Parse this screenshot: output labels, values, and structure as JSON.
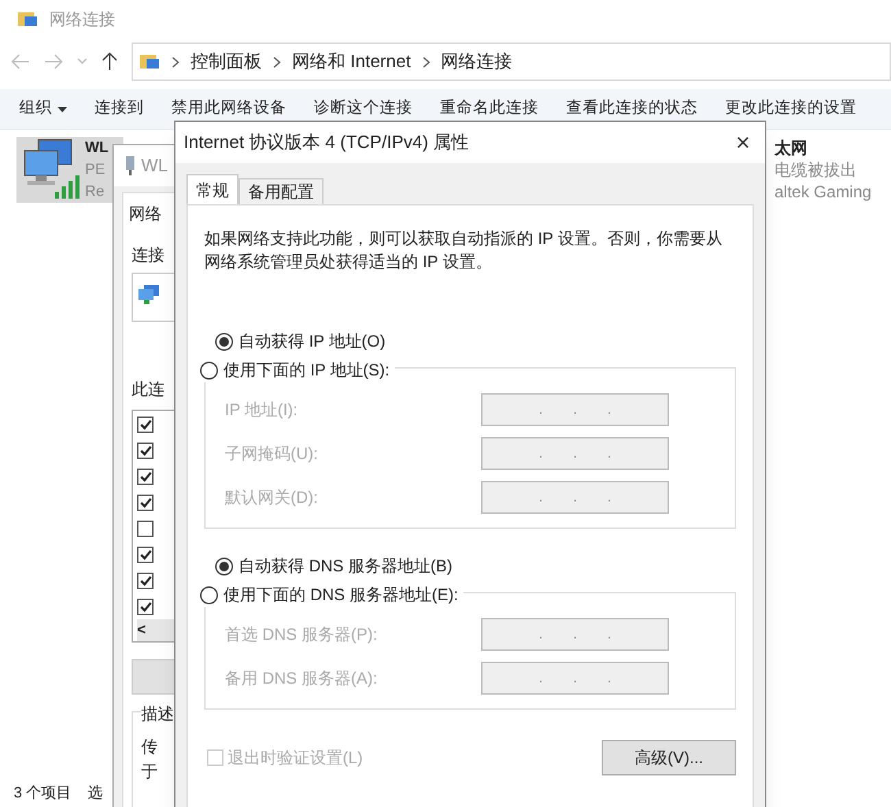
{
  "explorer": {
    "title": "网络连接",
    "breadcrumb": [
      "控制面板",
      "网络和 Internet",
      "网络连接"
    ],
    "toolbar": [
      {
        "label": "组织",
        "dropdown": true
      },
      {
        "label": "连接到",
        "dropdown": false
      },
      {
        "label": "禁用此网络设备",
        "dropdown": false
      },
      {
        "label": "诊断这个连接",
        "dropdown": false
      },
      {
        "label": "重命名此连接",
        "dropdown": false
      },
      {
        "label": "查看此连接的状态",
        "dropdown": false
      },
      {
        "label": "更改此连接的设置",
        "dropdown": false
      }
    ],
    "items": [
      {
        "lines": [
          "WL",
          "PE",
          "Re"
        ],
        "selected": true
      },
      {
        "lines": [
          "太网",
          "电缆被拔出",
          "altek Gaming"
        ],
        "selected": false
      }
    ],
    "status_bar": [
      "3 个项目",
      "选"
    ]
  },
  "wlan_window": {
    "title": "WL",
    "tab": "网络",
    "connect_label": "连接",
    "list_label": "此连",
    "components": [
      {
        "checked": true
      },
      {
        "checked": true
      },
      {
        "checked": true
      },
      {
        "checked": true
      },
      {
        "checked": false
      },
      {
        "checked": true
      },
      {
        "checked": true
      },
      {
        "checked": true
      }
    ],
    "scroll_left": "<",
    "description_label": "描述",
    "description_lines": [
      "传",
      "于"
    ]
  },
  "dialog": {
    "title": "Internet 协议版本 4 (TCP/IPv4) 属性",
    "close": "×",
    "tabs": [
      {
        "label": "常规",
        "selected": true
      },
      {
        "label": "备用配置",
        "selected": false
      }
    ],
    "intro": "如果网络支持此功能，则可以获取自动指派的 IP 设置。否则，你需要从网络系统管理员处获得适当的 IP 设置。",
    "sections": [
      {
        "auto": {
          "label": "自动获得 IP 地址(O)",
          "selected": true
        },
        "manual": {
          "label": "使用下面的 IP 地址(S):",
          "selected": false
        },
        "disabled": true,
        "fields": [
          {
            "label": "IP 地址(I):",
            "value": ".  .  ."
          },
          {
            "label": "子网掩码(U):",
            "value": ".  .  ."
          },
          {
            "label": "默认网关(D):",
            "value": ".  .  ."
          }
        ]
      },
      {
        "auto": {
          "label": "自动获得 DNS 服务器地址(B)",
          "selected": true
        },
        "manual": {
          "label": "使用下面的 DNS 服务器地址(E):",
          "selected": false
        },
        "disabled": true,
        "fields": [
          {
            "label": "首选 DNS 服务器(P):",
            "value": ".  .  ."
          },
          {
            "label": "备用 DNS 服务器(A):",
            "value": ".  .  ."
          }
        ]
      }
    ],
    "validate": {
      "label": "退出时验证设置(L)",
      "checked": false,
      "disabled": true
    },
    "advanced_button": "高级(V)..."
  }
}
